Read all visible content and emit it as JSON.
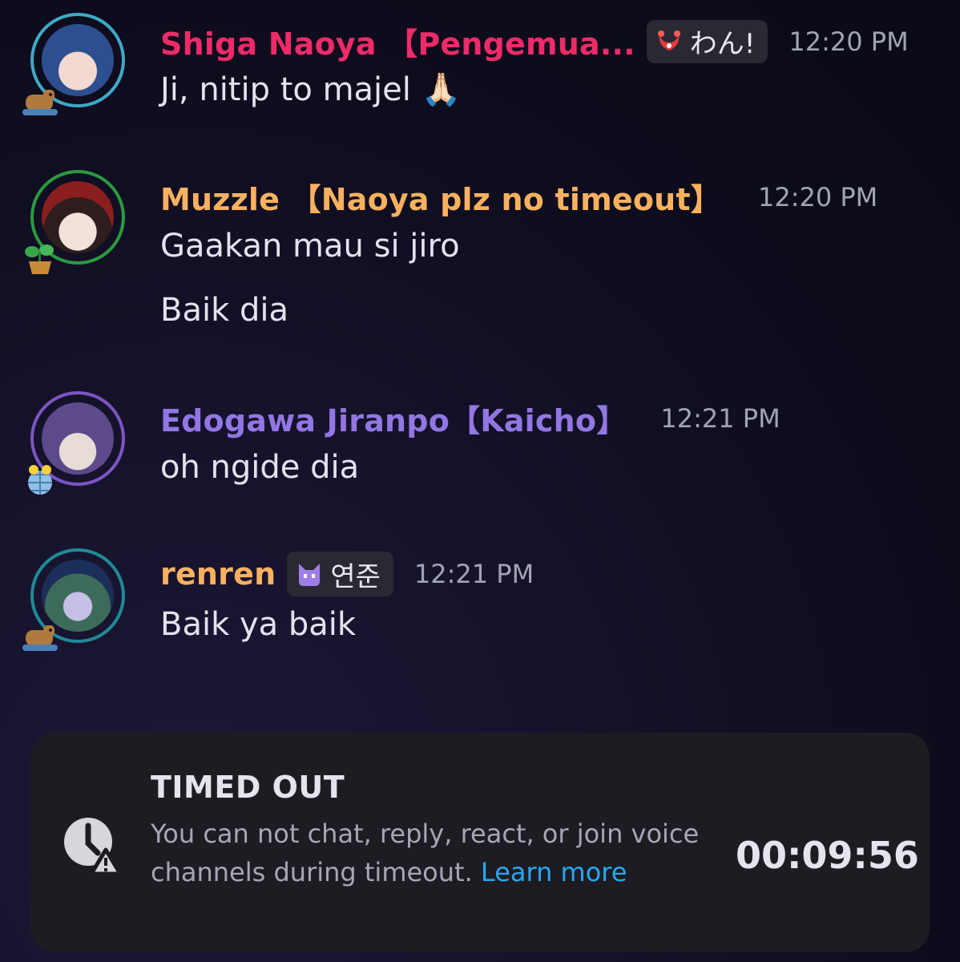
{
  "messages": [
    {
      "author": "Shiga Naoya 【Pengemua...",
      "author_color": "#ee2b68",
      "tag": "わん!",
      "tag_icon": "red-crab-icon",
      "time": "12:20 PM",
      "lines": [
        "Ji, nitip to majel 🙏🏻"
      ]
    },
    {
      "author": "Muzzle 【Naoya plz no timeout】",
      "author_color": "#f9b160",
      "time": "12:20 PM",
      "lines": [
        "Gaakan mau si jiro",
        "Baik dia"
      ]
    },
    {
      "author": "Edogawa Jiranpo【Kaicho】",
      "author_color": "#9276e4",
      "time": "12:21 PM",
      "lines": [
        "oh ngide dia"
      ]
    },
    {
      "author": "renren",
      "author_color": "#f9b160",
      "tag": "연준",
      "tag_icon": "purple-cat-icon",
      "time": "12:21 PM",
      "lines": [
        "Baik ya baik"
      ]
    }
  ],
  "timeout": {
    "title": "TIMED OUT",
    "description": "You can not chat, reply, react, or join voice channels during timeout.",
    "link": "Learn more",
    "countdown": "00:09:56",
    "icon": "clock-warning-icon",
    "link_color": "#27a8f2"
  }
}
